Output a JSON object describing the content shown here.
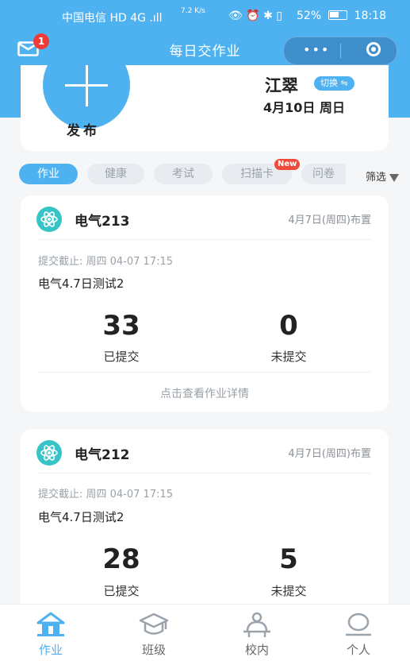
{
  "status_bar": {
    "carrier": "中国电信 HD 4G .ıll",
    "speed": "7.2 K/s",
    "battery": "52%",
    "time": "18:18"
  },
  "nav": {
    "title": "每日交作业",
    "mail_badge": "1",
    "more_icon": "more-dots-icon",
    "close_icon": "target-icon"
  },
  "profile": {
    "publish_label": "发布",
    "name": "江翠",
    "switch_label": "切换 ⇋",
    "date": "4月10日 周日"
  },
  "tabs": [
    {
      "label": "作业",
      "active": true
    },
    {
      "label": "健康",
      "active": false
    },
    {
      "label": "考试",
      "active": false
    },
    {
      "label": "扫描卡",
      "active": false,
      "badge": "New"
    },
    {
      "label": "问卷",
      "active": false
    }
  ],
  "filter_label": "筛选",
  "cards": [
    {
      "class_name": "电气213",
      "published": "4月7日(周四)布置",
      "deadline": "提交截止: 周四 04-07 17:15",
      "task_title": "电气4.7日测试2",
      "submitted_value": "33",
      "submitted_label": "已提交",
      "unsubmitted_value": "0",
      "unsubmitted_label": "未提交",
      "detail_link": "点击查看作业详情"
    },
    {
      "class_name": "电气212",
      "published": "4月7日(周四)布置",
      "deadline": "提交截止: 周四 04-07 17:15",
      "task_title": "电气4.7日测试2",
      "submitted_value": "28",
      "submitted_label": "已提交",
      "unsubmitted_value": "5",
      "unsubmitted_label": "未提交"
    }
  ],
  "tabbar": [
    {
      "label": "作业",
      "icon": "home-icon",
      "active": true
    },
    {
      "label": "班级",
      "icon": "graduation-cap-icon",
      "active": false
    },
    {
      "label": "校内",
      "icon": "school-person-icon",
      "active": false
    },
    {
      "label": "个人",
      "icon": "person-icon",
      "active": false
    }
  ],
  "colors": {
    "primary": "#4fb2f0",
    "badge_red": "#f03b3b",
    "atom_teal": "#37c4c8"
  }
}
